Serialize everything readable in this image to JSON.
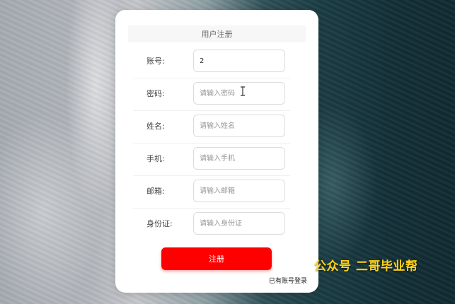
{
  "form": {
    "title": "用户注册",
    "fields": [
      {
        "label": "账号:",
        "value": "2",
        "placeholder": ""
      },
      {
        "label": "密码:",
        "value": "",
        "placeholder": "请输入密码"
      },
      {
        "label": "姓名:",
        "value": "",
        "placeholder": "请输入姓名"
      },
      {
        "label": "手机:",
        "value": "",
        "placeholder": "请输入手机"
      },
      {
        "label": "邮箱:",
        "value": "",
        "placeholder": "请输入邮箱"
      },
      {
        "label": "身份证:",
        "value": "",
        "placeholder": "请输入身份证"
      }
    ],
    "submit_label": "注册",
    "login_link": "已有账号登录"
  },
  "watermark": "公众号 二哥毕业帮",
  "colors": {
    "accent": "#ff0000",
    "watermark": "#ffd21a"
  },
  "icons": {
    "cursor": "text-cursor-icon"
  }
}
